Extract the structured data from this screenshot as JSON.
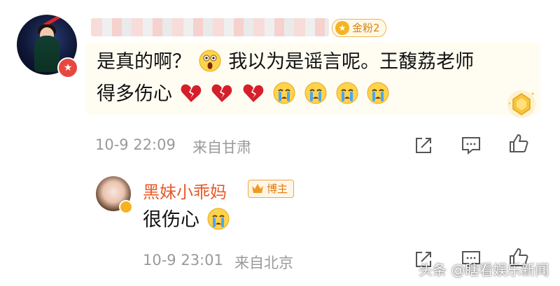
{
  "comment": {
    "fan_badge": "金粉2",
    "text_line1": "是真的啊？",
    "text_line1b": "我以为是谣言呢。王馥荔老师",
    "text_line2": "得多伤心",
    "time": "10-9 22:09",
    "location": "来自甘肃"
  },
  "reply": {
    "name": "黑妹小乖妈",
    "badge": "博主",
    "text": "很伤心",
    "time": "10-9 23:01",
    "location": "来自北京"
  },
  "watermark": "头条 @瞎看娱乐新闻",
  "colors": {
    "accent_orange": "#e8592a",
    "meta_gray": "#9a9a9a",
    "fan_badge": "#d68512",
    "heart_red": "#d61f2c"
  },
  "icons": [
    "share-icon",
    "comment-icon",
    "like-icon",
    "crying-emoji",
    "shocked-emoji",
    "broken-heart-emoji",
    "verified-badge-icon",
    "crown-icon"
  ]
}
